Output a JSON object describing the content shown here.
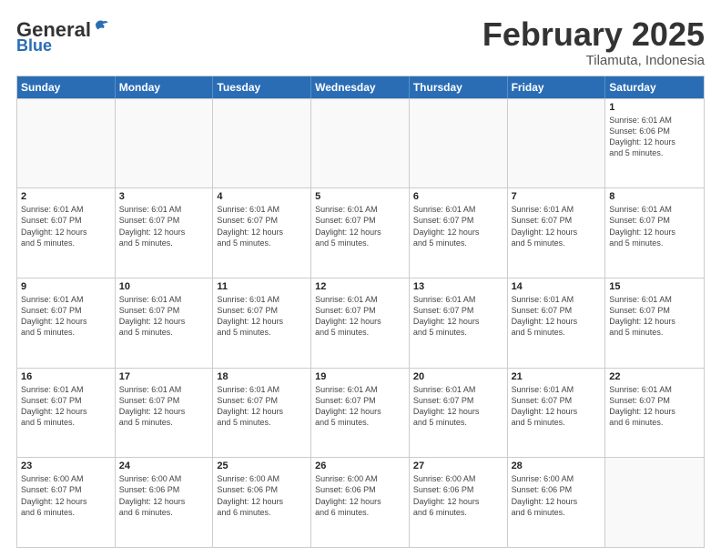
{
  "header": {
    "logo": {
      "general": "General",
      "blue": "Blue"
    },
    "title": "February 2025",
    "location": "Tilamuta, Indonesia"
  },
  "weekdays": [
    "Sunday",
    "Monday",
    "Tuesday",
    "Wednesday",
    "Thursday",
    "Friday",
    "Saturday"
  ],
  "weeks": [
    [
      {
        "day": "",
        "info": "",
        "empty": true
      },
      {
        "day": "",
        "info": "",
        "empty": true
      },
      {
        "day": "",
        "info": "",
        "empty": true
      },
      {
        "day": "",
        "info": "",
        "empty": true
      },
      {
        "day": "",
        "info": "",
        "empty": true
      },
      {
        "day": "",
        "info": "",
        "empty": true
      },
      {
        "day": "1",
        "info": "Sunrise: 6:01 AM\nSunset: 6:06 PM\nDaylight: 12 hours\nand 5 minutes.",
        "empty": false
      }
    ],
    [
      {
        "day": "2",
        "info": "Sunrise: 6:01 AM\nSunset: 6:07 PM\nDaylight: 12 hours\nand 5 minutes.",
        "empty": false
      },
      {
        "day": "3",
        "info": "Sunrise: 6:01 AM\nSunset: 6:07 PM\nDaylight: 12 hours\nand 5 minutes.",
        "empty": false
      },
      {
        "day": "4",
        "info": "Sunrise: 6:01 AM\nSunset: 6:07 PM\nDaylight: 12 hours\nand 5 minutes.",
        "empty": false
      },
      {
        "day": "5",
        "info": "Sunrise: 6:01 AM\nSunset: 6:07 PM\nDaylight: 12 hours\nand 5 minutes.",
        "empty": false
      },
      {
        "day": "6",
        "info": "Sunrise: 6:01 AM\nSunset: 6:07 PM\nDaylight: 12 hours\nand 5 minutes.",
        "empty": false
      },
      {
        "day": "7",
        "info": "Sunrise: 6:01 AM\nSunset: 6:07 PM\nDaylight: 12 hours\nand 5 minutes.",
        "empty": false
      },
      {
        "day": "8",
        "info": "Sunrise: 6:01 AM\nSunset: 6:07 PM\nDaylight: 12 hours\nand 5 minutes.",
        "empty": false
      }
    ],
    [
      {
        "day": "9",
        "info": "Sunrise: 6:01 AM\nSunset: 6:07 PM\nDaylight: 12 hours\nand 5 minutes.",
        "empty": false
      },
      {
        "day": "10",
        "info": "Sunrise: 6:01 AM\nSunset: 6:07 PM\nDaylight: 12 hours\nand 5 minutes.",
        "empty": false
      },
      {
        "day": "11",
        "info": "Sunrise: 6:01 AM\nSunset: 6:07 PM\nDaylight: 12 hours\nand 5 minutes.",
        "empty": false
      },
      {
        "day": "12",
        "info": "Sunrise: 6:01 AM\nSunset: 6:07 PM\nDaylight: 12 hours\nand 5 minutes.",
        "empty": false
      },
      {
        "day": "13",
        "info": "Sunrise: 6:01 AM\nSunset: 6:07 PM\nDaylight: 12 hours\nand 5 minutes.",
        "empty": false
      },
      {
        "day": "14",
        "info": "Sunrise: 6:01 AM\nSunset: 6:07 PM\nDaylight: 12 hours\nand 5 minutes.",
        "empty": false
      },
      {
        "day": "15",
        "info": "Sunrise: 6:01 AM\nSunset: 6:07 PM\nDaylight: 12 hours\nand 5 minutes.",
        "empty": false
      }
    ],
    [
      {
        "day": "16",
        "info": "Sunrise: 6:01 AM\nSunset: 6:07 PM\nDaylight: 12 hours\nand 5 minutes.",
        "empty": false
      },
      {
        "day": "17",
        "info": "Sunrise: 6:01 AM\nSunset: 6:07 PM\nDaylight: 12 hours\nand 5 minutes.",
        "empty": false
      },
      {
        "day": "18",
        "info": "Sunrise: 6:01 AM\nSunset: 6:07 PM\nDaylight: 12 hours\nand 5 minutes.",
        "empty": false
      },
      {
        "day": "19",
        "info": "Sunrise: 6:01 AM\nSunset: 6:07 PM\nDaylight: 12 hours\nand 5 minutes.",
        "empty": false
      },
      {
        "day": "20",
        "info": "Sunrise: 6:01 AM\nSunset: 6:07 PM\nDaylight: 12 hours\nand 5 minutes.",
        "empty": false
      },
      {
        "day": "21",
        "info": "Sunrise: 6:01 AM\nSunset: 6:07 PM\nDaylight: 12 hours\nand 5 minutes.",
        "empty": false
      },
      {
        "day": "22",
        "info": "Sunrise: 6:01 AM\nSunset: 6:07 PM\nDaylight: 12 hours\nand 6 minutes.",
        "empty": false
      }
    ],
    [
      {
        "day": "23",
        "info": "Sunrise: 6:00 AM\nSunset: 6:07 PM\nDaylight: 12 hours\nand 6 minutes.",
        "empty": false
      },
      {
        "day": "24",
        "info": "Sunrise: 6:00 AM\nSunset: 6:06 PM\nDaylight: 12 hours\nand 6 minutes.",
        "empty": false
      },
      {
        "day": "25",
        "info": "Sunrise: 6:00 AM\nSunset: 6:06 PM\nDaylight: 12 hours\nand 6 minutes.",
        "empty": false
      },
      {
        "day": "26",
        "info": "Sunrise: 6:00 AM\nSunset: 6:06 PM\nDaylight: 12 hours\nand 6 minutes.",
        "empty": false
      },
      {
        "day": "27",
        "info": "Sunrise: 6:00 AM\nSunset: 6:06 PM\nDaylight: 12 hours\nand 6 minutes.",
        "empty": false
      },
      {
        "day": "28",
        "info": "Sunrise: 6:00 AM\nSunset: 6:06 PM\nDaylight: 12 hours\nand 6 minutes.",
        "empty": false
      },
      {
        "day": "",
        "info": "",
        "empty": true
      }
    ]
  ]
}
